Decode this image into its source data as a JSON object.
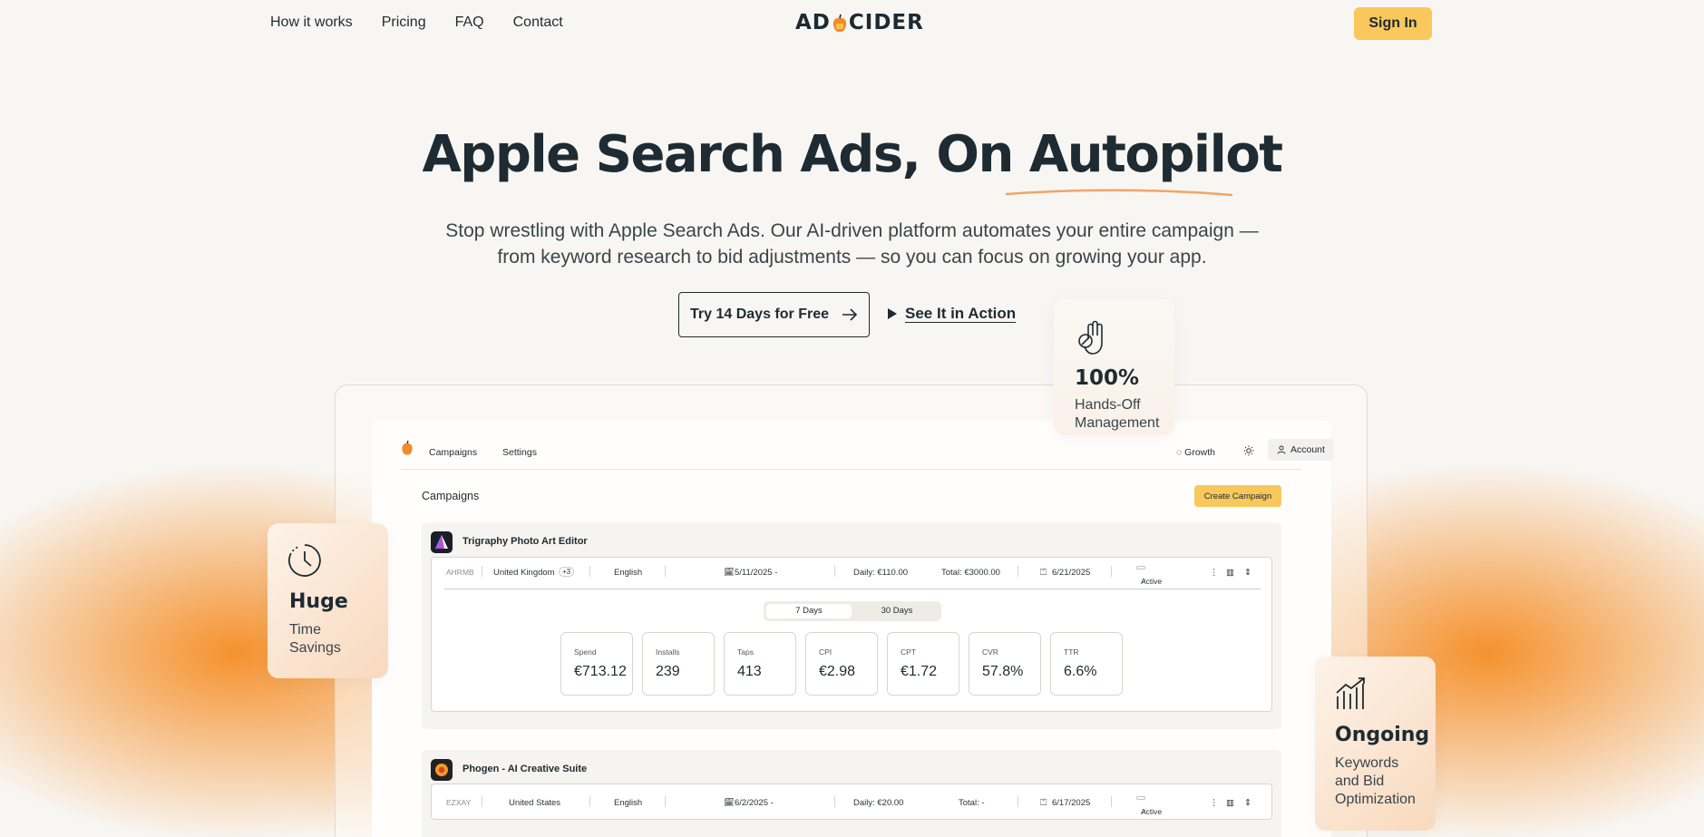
{
  "nav": {
    "links": [
      "How it works",
      "Pricing",
      "FAQ",
      "Contact"
    ],
    "logo_left": "AD",
    "logo_right": "CIDER",
    "signin": "Sign In"
  },
  "hero": {
    "title": "Apple Search Ads, On Autopilot",
    "subtitle_line1": "Stop wrestling with Apple Search Ads. Our AI-driven platform automates your entire campaign —",
    "subtitle_line2": "from keyword research to bid adjustments — so you can focus on growing your app.",
    "cta_primary": "Try 14 Days for Free",
    "cta_secondary": "See It in Action"
  },
  "badges": {
    "handsoff": {
      "big": "100%",
      "line1": "Hands-Off",
      "line2": "Management"
    },
    "time": {
      "big": "Huge",
      "line1": "Time",
      "line2": "Savings"
    },
    "ongoing": {
      "big": "Ongoing",
      "line1": "Keywords",
      "line2": "and Bid",
      "line3": "Optimization"
    }
  },
  "app": {
    "nav": {
      "campaigns": "Campaigns",
      "settings": "Settings",
      "growth": "Growth",
      "account": "Account"
    },
    "page_title": "Campaigns",
    "create_button": "Create Campaign",
    "campaigns": [
      {
        "name": "Trigraphy Photo Art Editor",
        "id": "AHRMB",
        "country": "United Kingdom",
        "extra": "+3",
        "language": "English",
        "start": "5/11/2025 -",
        "daily": "Daily: €110.00",
        "total": "Total: €3000.00",
        "end": "6/21/2025",
        "status": "Active",
        "toggle": [
          "7 Days",
          "30 Days"
        ],
        "metrics": [
          {
            "label": "Spend",
            "value": "€713.12"
          },
          {
            "label": "Installs",
            "value": "239"
          },
          {
            "label": "Taps",
            "value": "413"
          },
          {
            "label": "CPI",
            "value": "€2.98"
          },
          {
            "label": "CPT",
            "value": "€1.72"
          },
          {
            "label": "CVR",
            "value": "57.8%"
          },
          {
            "label": "TTR",
            "value": "6.6%"
          }
        ]
      },
      {
        "name": "Phogen - AI Creative Suite",
        "id": "EZXAY",
        "country": "United States",
        "language": "English",
        "start": "6/2/2025 -",
        "daily": "Daily: €20.00",
        "total": "Total: -",
        "end": "6/17/2025",
        "status": "Active"
      }
    ]
  },
  "colors": {
    "accent": "#f9c75c",
    "orange_glow": "#f58c23",
    "text_dark": "#1e2b32"
  }
}
